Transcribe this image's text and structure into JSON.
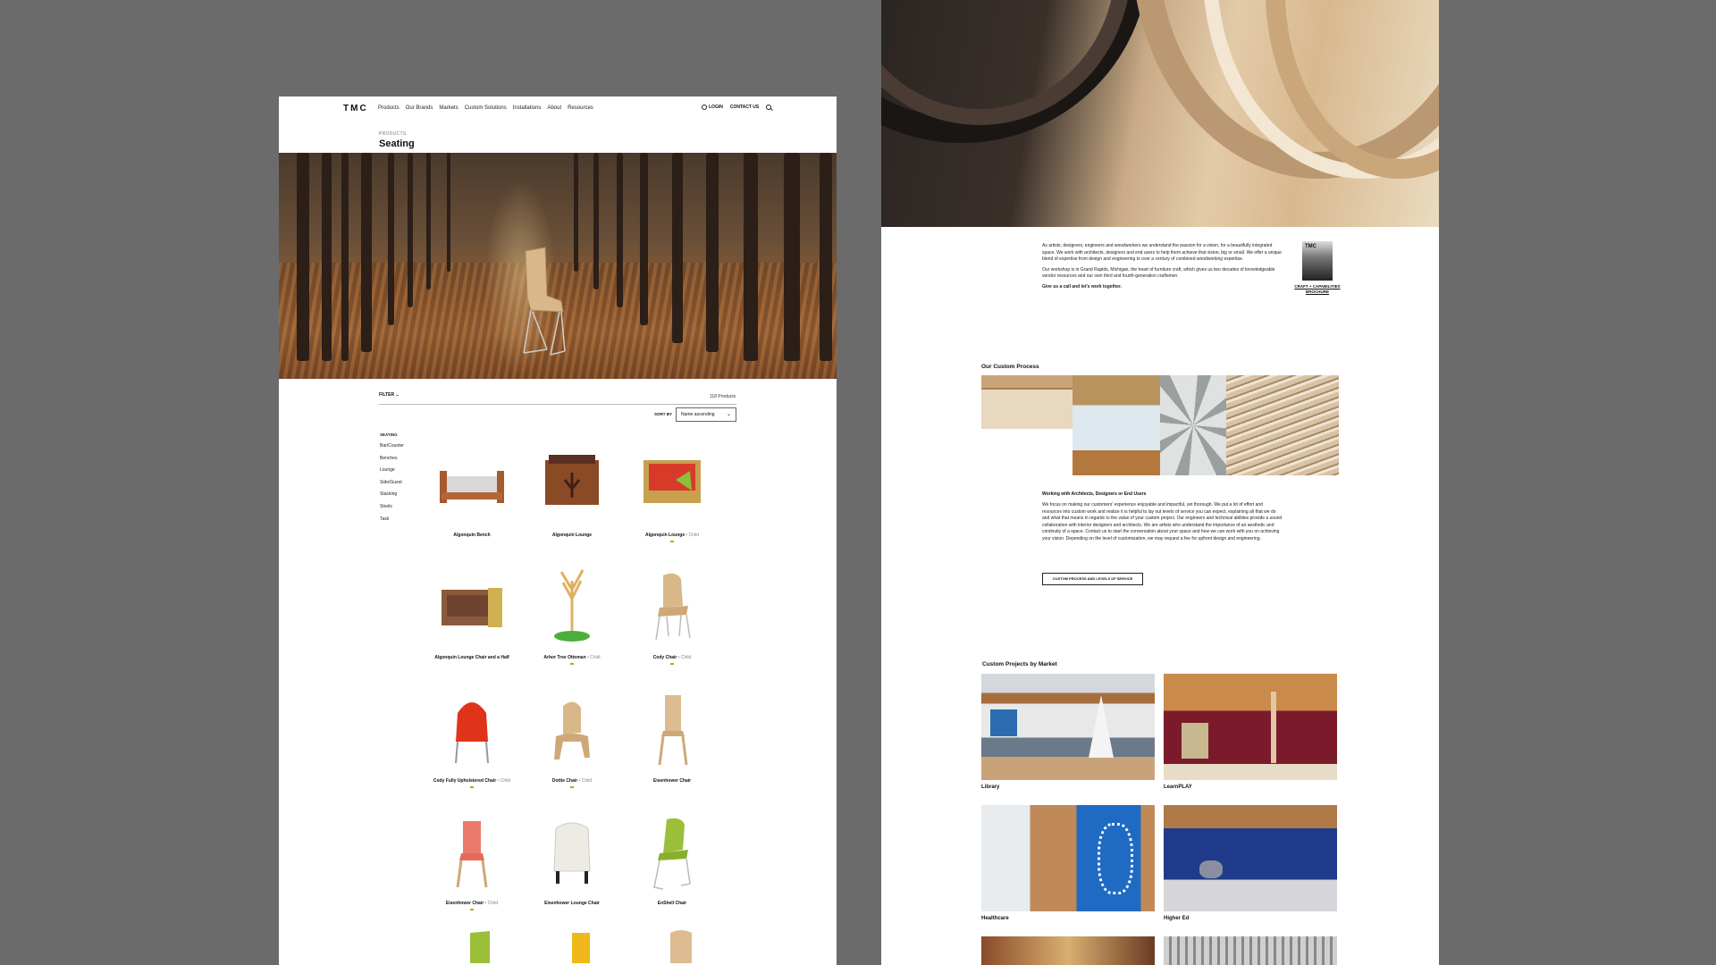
{
  "left_page": {
    "logo": "TMC",
    "nav": [
      "Products",
      "Our Brands",
      "Markets",
      "Custom Solutions",
      "Installations",
      "About",
      "Resources"
    ],
    "login": "LOGIN",
    "contact": "CONTACT US",
    "breadcrumb": "PRODUCTS",
    "title": "Seating",
    "filter_label": "FILTER",
    "product_count": "118 Products",
    "sort_label": "SORT BY",
    "sort_value": "Name ascending",
    "categories": {
      "heading": "SEATING",
      "items": [
        "Bar/Counter",
        "Benches",
        "Lounge",
        "Side/Guest",
        "Stacking",
        "Stools",
        "Task"
      ]
    },
    "products": [
      {
        "name": "Algonquin Bench",
        "child": ""
      },
      {
        "name": "Algonquin Lounge",
        "child": ""
      },
      {
        "name": "Algonquin Lounge",
        "child": "• Child"
      },
      {
        "name": "Algonquin Lounge Chair and a Half",
        "child": ""
      },
      {
        "name": "Arbor Tree Ottoman",
        "child": "• Child"
      },
      {
        "name": "Cody Chair",
        "child": "• Child"
      },
      {
        "name": "Cody Fully Upholstered Chair",
        "child": "• Child"
      },
      {
        "name": "Dottie Chair",
        "child": "• Child"
      },
      {
        "name": "Eisenhower Chair",
        "child": ""
      },
      {
        "name": "Eisenhower Chair",
        "child": "• Child"
      },
      {
        "name": "Eisenhower Lounge Chair",
        "child": ""
      },
      {
        "name": "EnShell Chair",
        "child": ""
      }
    ]
  },
  "right_page": {
    "intro": [
      "As artists, designers, engineers and woodworkers we understand the passion for a vision, for a beautifully integrated space. We work with architects, designers and end users to help them achieve that vision, big or small. We offer a unique blend of expertise from design and engineering to over a century of combined woodworking expertise.",
      "Our workshop is in Grand Rapids, Michigan, the heart of furniture craft, which gives us two decades of knowledgeable vendor resources and our own third and fourth-generation craftsmen.",
      "Give us a call and let's work together."
    ],
    "brochure_logo": "TMC",
    "brochure_label": "CRAFT + CAPABILITIES BROCHURE",
    "process_title": "Our Custom Process",
    "working_heading": "Working with Architects, Designers or End Users",
    "working_text": "We focus on making our customers' experience enjoyable and impactful, yet thorough. We put a lot of effort and resources into custom work and realize it is helpful to lay out levels of service you can expect, explaining all that we do and what that means in regards to the value of your custom project. Our engineers and technical abilities provide a sound collaboration with interior designers and architects. We are artists who understand the importance of an aesthetic and continuity of a space. Contact us to start the conversation about your space and how we can work with you on achieving your vision. Depending on the level of customization, we may request a fee for upfront design and engineering.",
    "cta_label": "CUSTOM PROCESS AND LEVELS OF SERVICE",
    "projects_title": "Custom Projects by Market",
    "projects": [
      "Library",
      "LearnPLAY",
      "Healthcare",
      "Higher Ed"
    ]
  }
}
